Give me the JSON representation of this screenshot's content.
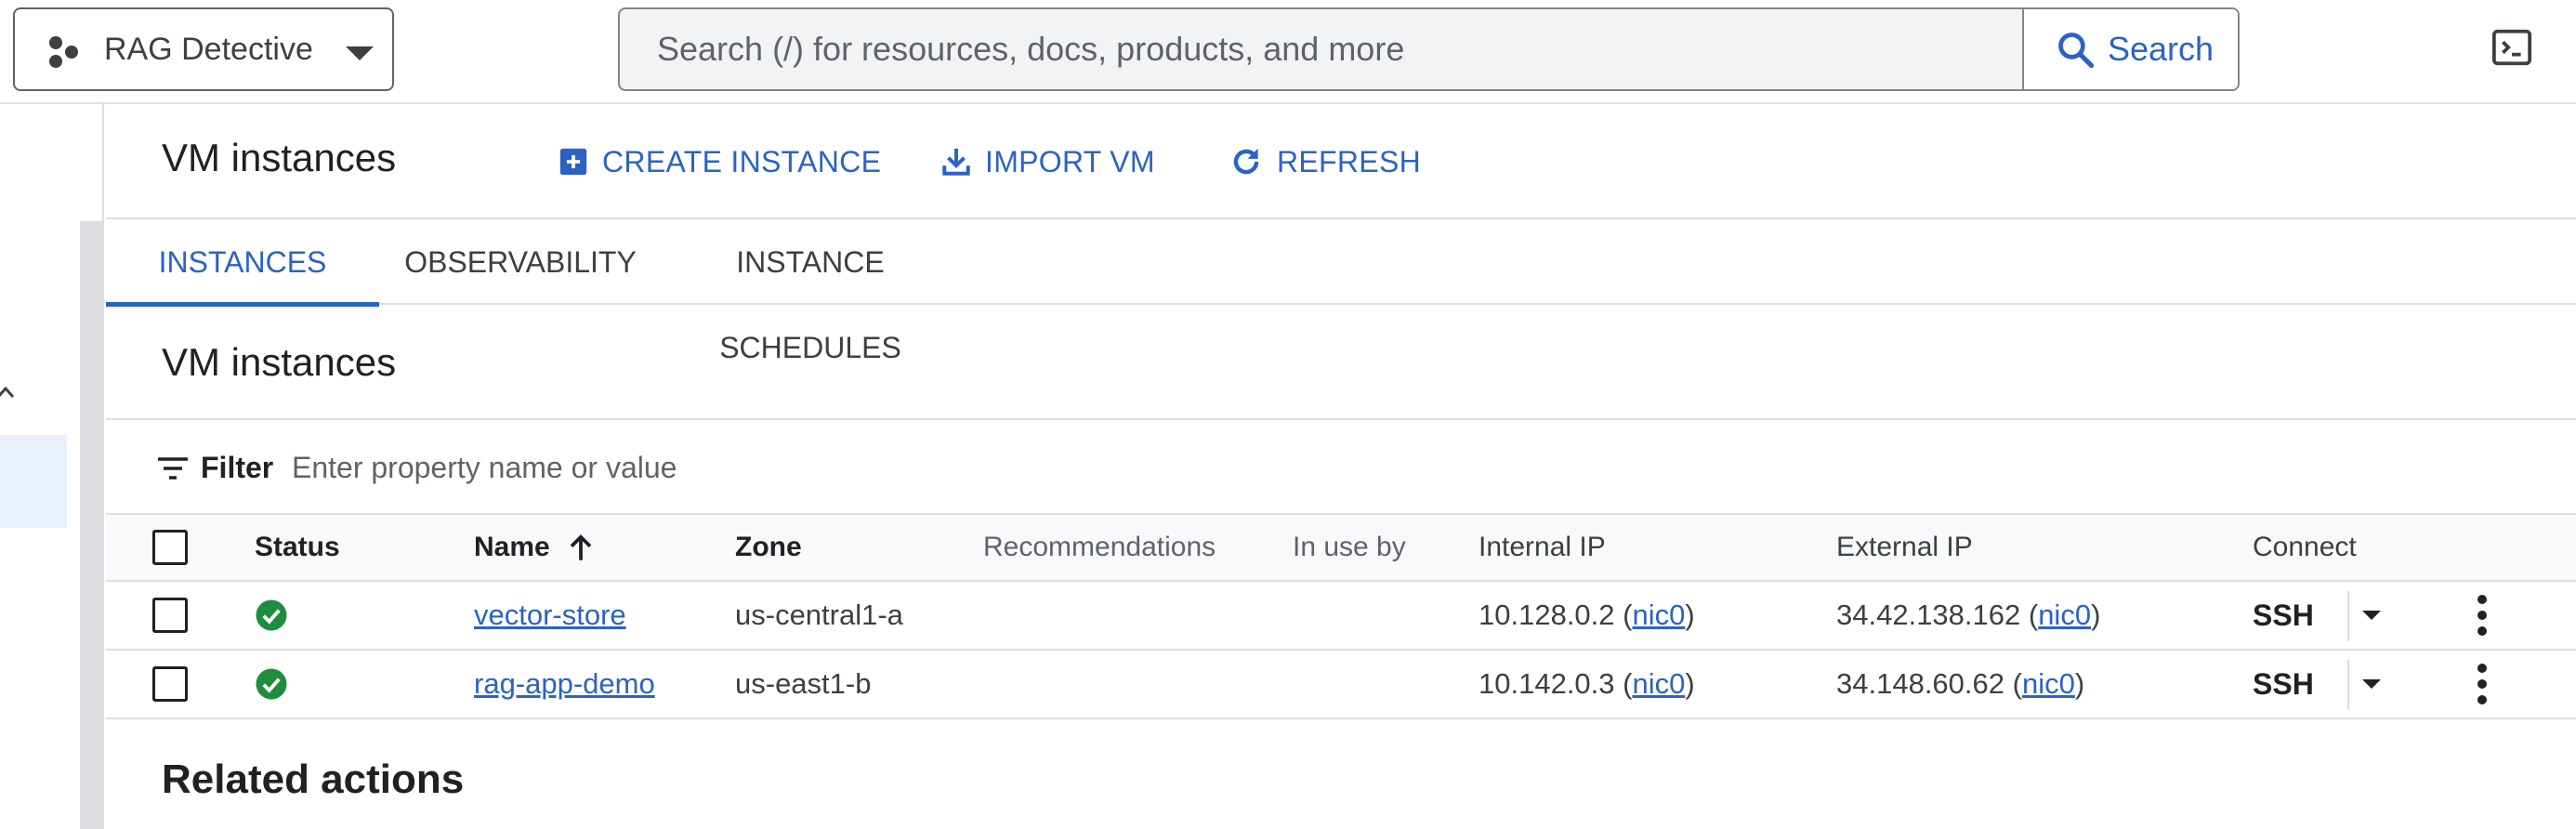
{
  "header": {
    "project_name": "RAG Detective",
    "search_placeholder": "Search (/) for resources, docs, products, and more",
    "search_button_label": "Search"
  },
  "page": {
    "title": "VM instances",
    "actions": {
      "create": "CREATE INSTANCE",
      "import": "IMPORT VM",
      "refresh": "REFRESH"
    }
  },
  "tabs": [
    {
      "label": "INSTANCES",
      "active": true
    },
    {
      "label": "OBSERVABILITY",
      "active": false
    },
    {
      "label": "INSTANCE SCHEDULES",
      "active": false
    }
  ],
  "section_title": "VM instances",
  "filter": {
    "label": "Filter",
    "placeholder": "Enter property name or value"
  },
  "table": {
    "columns": {
      "status": "Status",
      "name": "Name",
      "zone": "Zone",
      "recommendations": "Recommendations",
      "in_use_by": "In use by",
      "internal_ip": "Internal IP",
      "external_ip": "External IP",
      "connect": "Connect"
    },
    "rows": [
      {
        "name": "vector-store",
        "zone": "us-central1-a",
        "internal_ip": "10.128.0.2",
        "internal_nic": "nic0",
        "external_ip": "34.42.138.162",
        "external_nic": "nic0",
        "connect": "SSH"
      },
      {
        "name": "rag-app-demo",
        "zone": "us-east1-b",
        "internal_ip": "10.142.0.3",
        "internal_nic": "nic0",
        "external_ip": "34.148.60.62",
        "external_nic": "nic0",
        "connect": "SSH"
      }
    ]
  },
  "related_actions_title": "Related actions",
  "colors": {
    "accent": "#2b63c5",
    "status_ok": "#1e8e3e"
  }
}
